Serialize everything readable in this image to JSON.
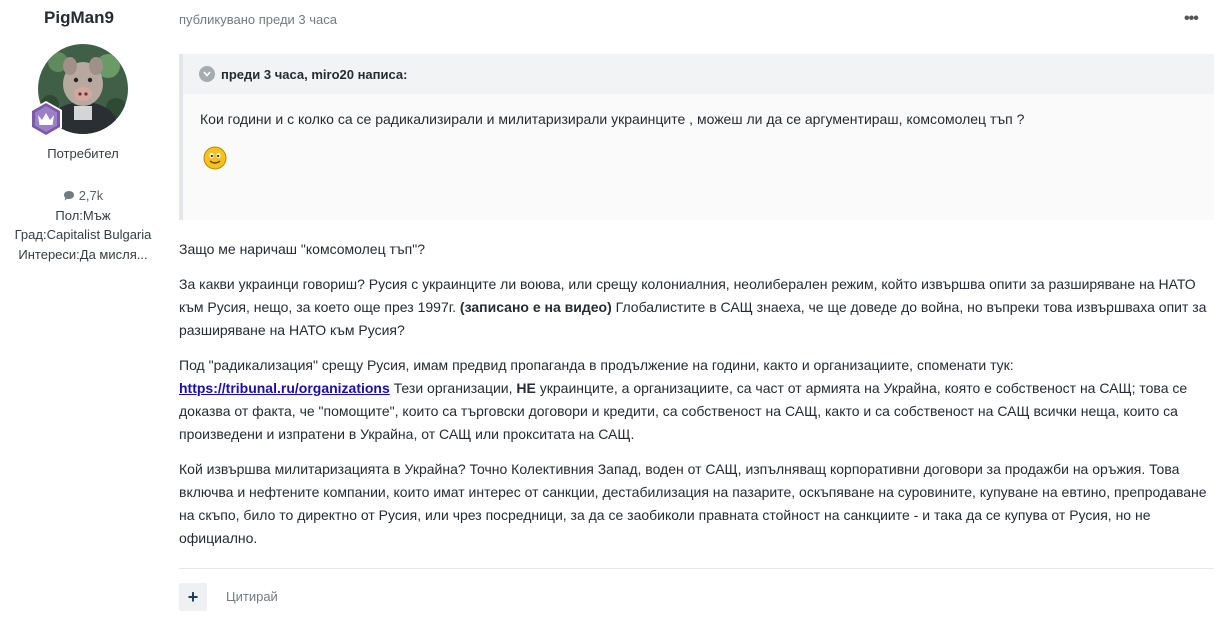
{
  "author": {
    "name": "PigMan9",
    "group": "Потребител",
    "posts": "2,7k",
    "fields": [
      "Пол:Мъж",
      "Град:Capitalist Bulgaria",
      "Интереси:Да мисля..."
    ]
  },
  "post": {
    "meta": "публикувано преди 3 часа",
    "menu_icon": "ellipsis-icon",
    "quote": {
      "header": "преди 3 часа, miro20 написа:",
      "text": "Кои години и с колко са  се радикализирали и милитаризирали украинците , можеш ли да се аргументираш, комсомолец тъп ?"
    },
    "paragraphs": {
      "p1": "Защо ме наричаш \"комсомолец тъп\"?",
      "p2a": "За какви украинци говориш? Русия с украинците ли воюва, или срещу колониалния, неолиберален режим, който извършва опити за разширяване на НАТО към Русия, нещо, за което още през 1997г. ",
      "p2b": "(записано е на видео)",
      "p2c": " Глобалистите в САЩ знаеха, че ще доведе до война, но въпреки това извършваха опит за разширяване на НАТО към Русия?",
      "p3a": "Под \"радикализация\" срещу Русия, имам предвид пропаганда в продължение на години, както и организациите, споменати тук: ",
      "p3link": "https://tribunal.ru/organizations",
      "p3b": " Тези организации, ",
      "p3c": "НЕ",
      "p3d": " украинците, а организациите, са част от армията на Украйна, която е собственост на САЩ; това се доказва от факта, че \"помощите\", които са търговски договори и кредити, са собственост на САЩ, както и са собственост на САЩ всички неща, които са произведени и изпратени в Украйна, от САЩ или прокситата  на САЩ.",
      "p4": "Кой извършва милитаризацията в Украйна? Точно Колективния Запад, воден от САЩ, изпълняващ корпоративни договори за продажби на оръжия. Това включва и нефтените компании, които имат интерес от санкции, дестабилизация на пазарите, оскъпяване на суровините, купуване на евтино, препродаване на скъпо, било то директно от Русия, или чрез посредници, за да се заобиколи правната стойност на санкциите - и така да се купува от Русия, но не официално."
    },
    "actions": {
      "reaction_label": "+",
      "quote_label": "Цитирай"
    }
  }
}
